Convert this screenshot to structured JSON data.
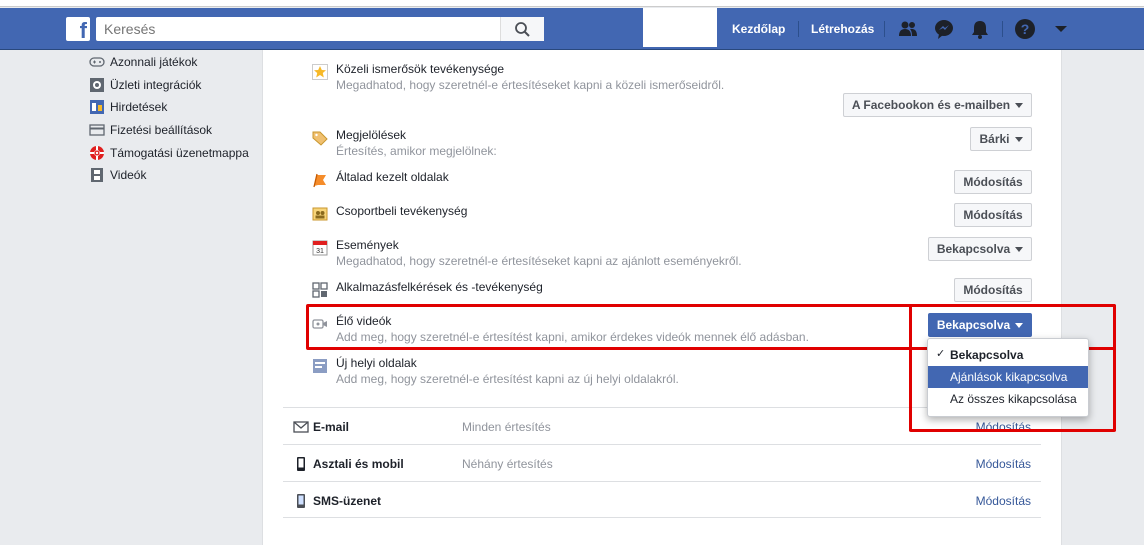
{
  "topbar": {
    "logo": "f",
    "search_placeholder": "Keresés",
    "nav_home": "Kezdőlap",
    "nav_create": "Létrehozás",
    "brand_color": "#4267b2"
  },
  "sidebar": {
    "items": [
      {
        "label": "Azonnali játékok",
        "icon": "gamepad-icon"
      },
      {
        "label": "Üzleti integrációk",
        "icon": "gear-icon"
      },
      {
        "label": "Hirdetések",
        "icon": "ads-icon"
      },
      {
        "label": "Fizetési beállítások",
        "icon": "credit-card-icon"
      },
      {
        "label": "Támogatási üzenetmappa",
        "icon": "lifebuoy-icon"
      },
      {
        "label": "Videók",
        "icon": "film-icon"
      }
    ]
  },
  "notifications": [
    {
      "title": "Közeli ismerősök tevékenysége",
      "desc": "Megadhatod, hogy szeretnél-e értesítéseket kapni a közeli ismerőseidről.",
      "button": "A Facebookon és e-mailben",
      "icon": "star-icon"
    },
    {
      "title": "Megjelölések",
      "desc": "Értesítés, amikor megjelölnek:",
      "button": "Bárki",
      "icon": "tag-icon"
    },
    {
      "title": "Általad kezelt oldalak",
      "desc": "",
      "button": "Módosítás",
      "icon": "flag-icon"
    },
    {
      "title": "Csoportbeli tevékenység",
      "desc": "",
      "button": "Módosítás",
      "icon": "group-icon"
    },
    {
      "title": "Események",
      "desc": "Megadhatod, hogy szeretnél-e értesítéseket kapni az ajánlott eseményekről.",
      "button": "Bekapcsolva",
      "icon": "calendar-icon"
    },
    {
      "title": "Alkalmazásfelkérések és -tevékenység",
      "desc": "",
      "button": "Módosítás",
      "icon": "apps-icon"
    },
    {
      "title": "Élő videók",
      "desc": "Add meg, hogy szeretnél-e értesítést kapni, amikor érdekes videók mennek élő adásban.",
      "button": "Bekapcsolva",
      "icon": "video-camera-icon"
    },
    {
      "title": "Új helyi oldalak",
      "desc": "Add meg, hogy szeretnél-e értesítést kapni az új helyi oldalakról.",
      "icon": "page-icon"
    }
  ],
  "dropdown": {
    "items": [
      "Bekapcsolva",
      "Ajánlások kikapcsolva",
      "Az összes kikapcsolása"
    ],
    "checked": "✓"
  },
  "sections": [
    {
      "title": "E-mail",
      "value": "Minden értesítés",
      "link": "Módosítás",
      "icon": "envelope-icon"
    },
    {
      "title": "Asztali és mobil",
      "value": "Néhány értesítés",
      "link": "Módosítás",
      "icon": "mobile-icon"
    },
    {
      "title": "SMS-üzenet",
      "value": "",
      "link": "Módosítás",
      "icon": "phone-icon"
    }
  ]
}
